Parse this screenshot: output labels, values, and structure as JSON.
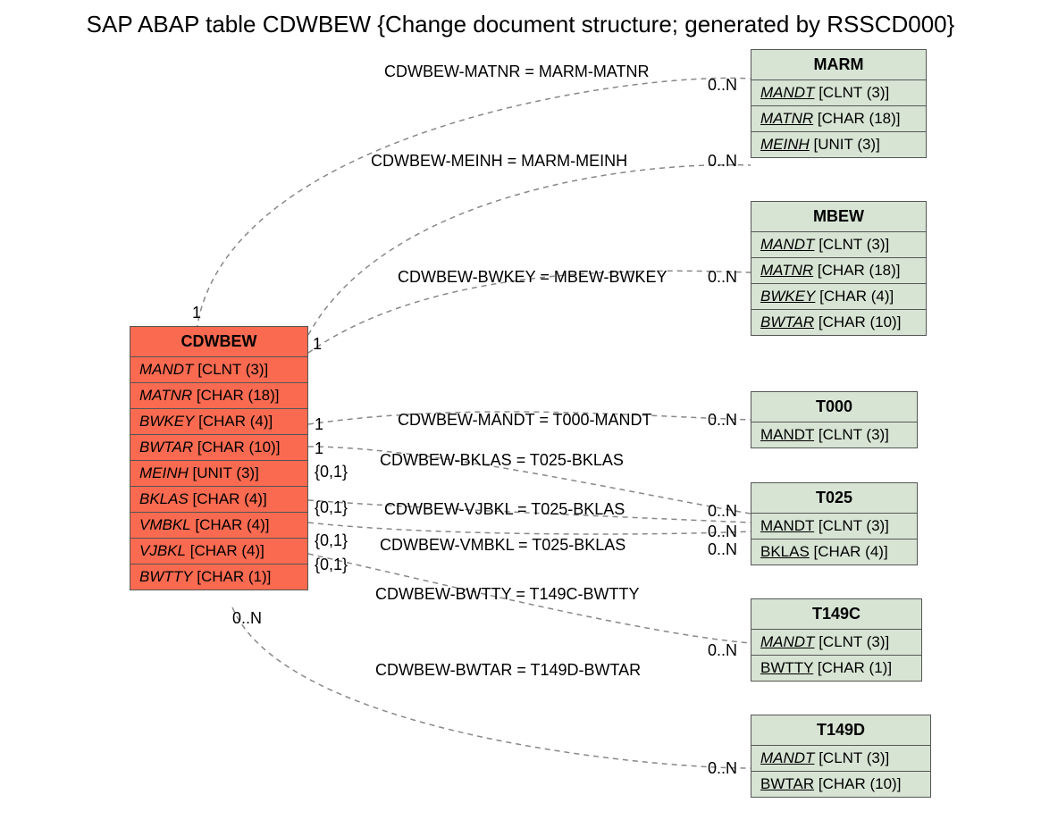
{
  "title": "SAP ABAP table CDWBEW {Change document structure; generated by RSSCD000}",
  "main_entity": {
    "name": "CDWBEW",
    "fields": [
      {
        "name": "MANDT",
        "type": "[CLNT (3)]",
        "key": true
      },
      {
        "name": "MATNR",
        "type": "[CHAR (18)]",
        "key": true
      },
      {
        "name": "BWKEY",
        "type": "[CHAR (4)]",
        "key": true
      },
      {
        "name": "BWTAR",
        "type": "[CHAR (10)]",
        "key": true
      },
      {
        "name": "MEINH",
        "type": "[UNIT (3)]",
        "key": true
      },
      {
        "name": "BKLAS",
        "type": "[CHAR (4)]",
        "key": true
      },
      {
        "name": "VMBKL",
        "type": "[CHAR (4)]",
        "key": true
      },
      {
        "name": "VJBKL",
        "type": "[CHAR (4)]",
        "key": true
      },
      {
        "name": "BWTTY",
        "type": "[CHAR (1)]",
        "key": true
      }
    ]
  },
  "related": {
    "MARM": {
      "name": "MARM",
      "fields": [
        {
          "name": "MANDT",
          "type": "[CLNT (3)]",
          "key": true,
          "u": true
        },
        {
          "name": "MATNR",
          "type": "[CHAR (18)]",
          "key": true,
          "u": true
        },
        {
          "name": "MEINH",
          "type": "[UNIT (3)]",
          "key": true,
          "u": true
        }
      ]
    },
    "MBEW": {
      "name": "MBEW",
      "fields": [
        {
          "name": "MANDT",
          "type": "[CLNT (3)]",
          "key": true,
          "u": true
        },
        {
          "name": "MATNR",
          "type": "[CHAR (18)]",
          "key": true,
          "u": true
        },
        {
          "name": "BWKEY",
          "type": "[CHAR (4)]",
          "key": true,
          "u": true
        },
        {
          "name": "BWTAR",
          "type": "[CHAR (10)]",
          "key": true,
          "u": true
        }
      ]
    },
    "T000": {
      "name": "T000",
      "fields": [
        {
          "name": "MANDT",
          "type": "[CLNT (3)]",
          "u": true
        }
      ]
    },
    "T025": {
      "name": "T025",
      "fields": [
        {
          "name": "MANDT",
          "type": "[CLNT (3)]",
          "u": true
        },
        {
          "name": "BKLAS",
          "type": "[CHAR (4)]",
          "u": true
        }
      ]
    },
    "T149C": {
      "name": "T149C",
      "fields": [
        {
          "name": "MANDT",
          "type": "[CLNT (3)]",
          "key": true,
          "u": true
        },
        {
          "name": "BWTTY",
          "type": "[CHAR (1)]",
          "u": true
        }
      ]
    },
    "T149D": {
      "name": "T149D",
      "fields": [
        {
          "name": "MANDT",
          "type": "[CLNT (3)]",
          "key": true,
          "u": true
        },
        {
          "name": "BWTAR",
          "type": "[CHAR (10)]",
          "u": true
        }
      ]
    }
  },
  "relations": [
    {
      "text": "CDWBEW-MATNR = MARM-MATNR",
      "src_card": "1",
      "dst_card": "0..N"
    },
    {
      "text": "CDWBEW-MEINH = MARM-MEINH",
      "src_card": "",
      "dst_card": "0..N"
    },
    {
      "text": "CDWBEW-BWKEY = MBEW-BWKEY",
      "src_card": "1",
      "dst_card": "0..N"
    },
    {
      "text": "CDWBEW-MANDT = T000-MANDT",
      "src_card": "1",
      "dst_card": "0..N"
    },
    {
      "text": "CDWBEW-BKLAS = T025-BKLAS",
      "src_card": "1",
      "dst_card": ""
    },
    {
      "text": "CDWBEW-VJBKL = T025-BKLAS",
      "src_card": "{0,1}",
      "dst_card": "0..N"
    },
    {
      "text": "CDWBEW-VMBKL = T025-BKLAS",
      "src_card": "{0,1}",
      "dst_card": "0..N"
    },
    {
      "text": "CDWBEW-BWTTY = T149C-BWTTY",
      "src_card": "{0,1}",
      "dst_card": "0..N"
    },
    {
      "text": "CDWBEW-BWTAR = T149D-BWTAR",
      "src_card": "0..N",
      "dst_card": "0..N"
    }
  ],
  "extra_cards": {
    "c01": "{0,1}",
    "c0n_alt": "0..N"
  }
}
